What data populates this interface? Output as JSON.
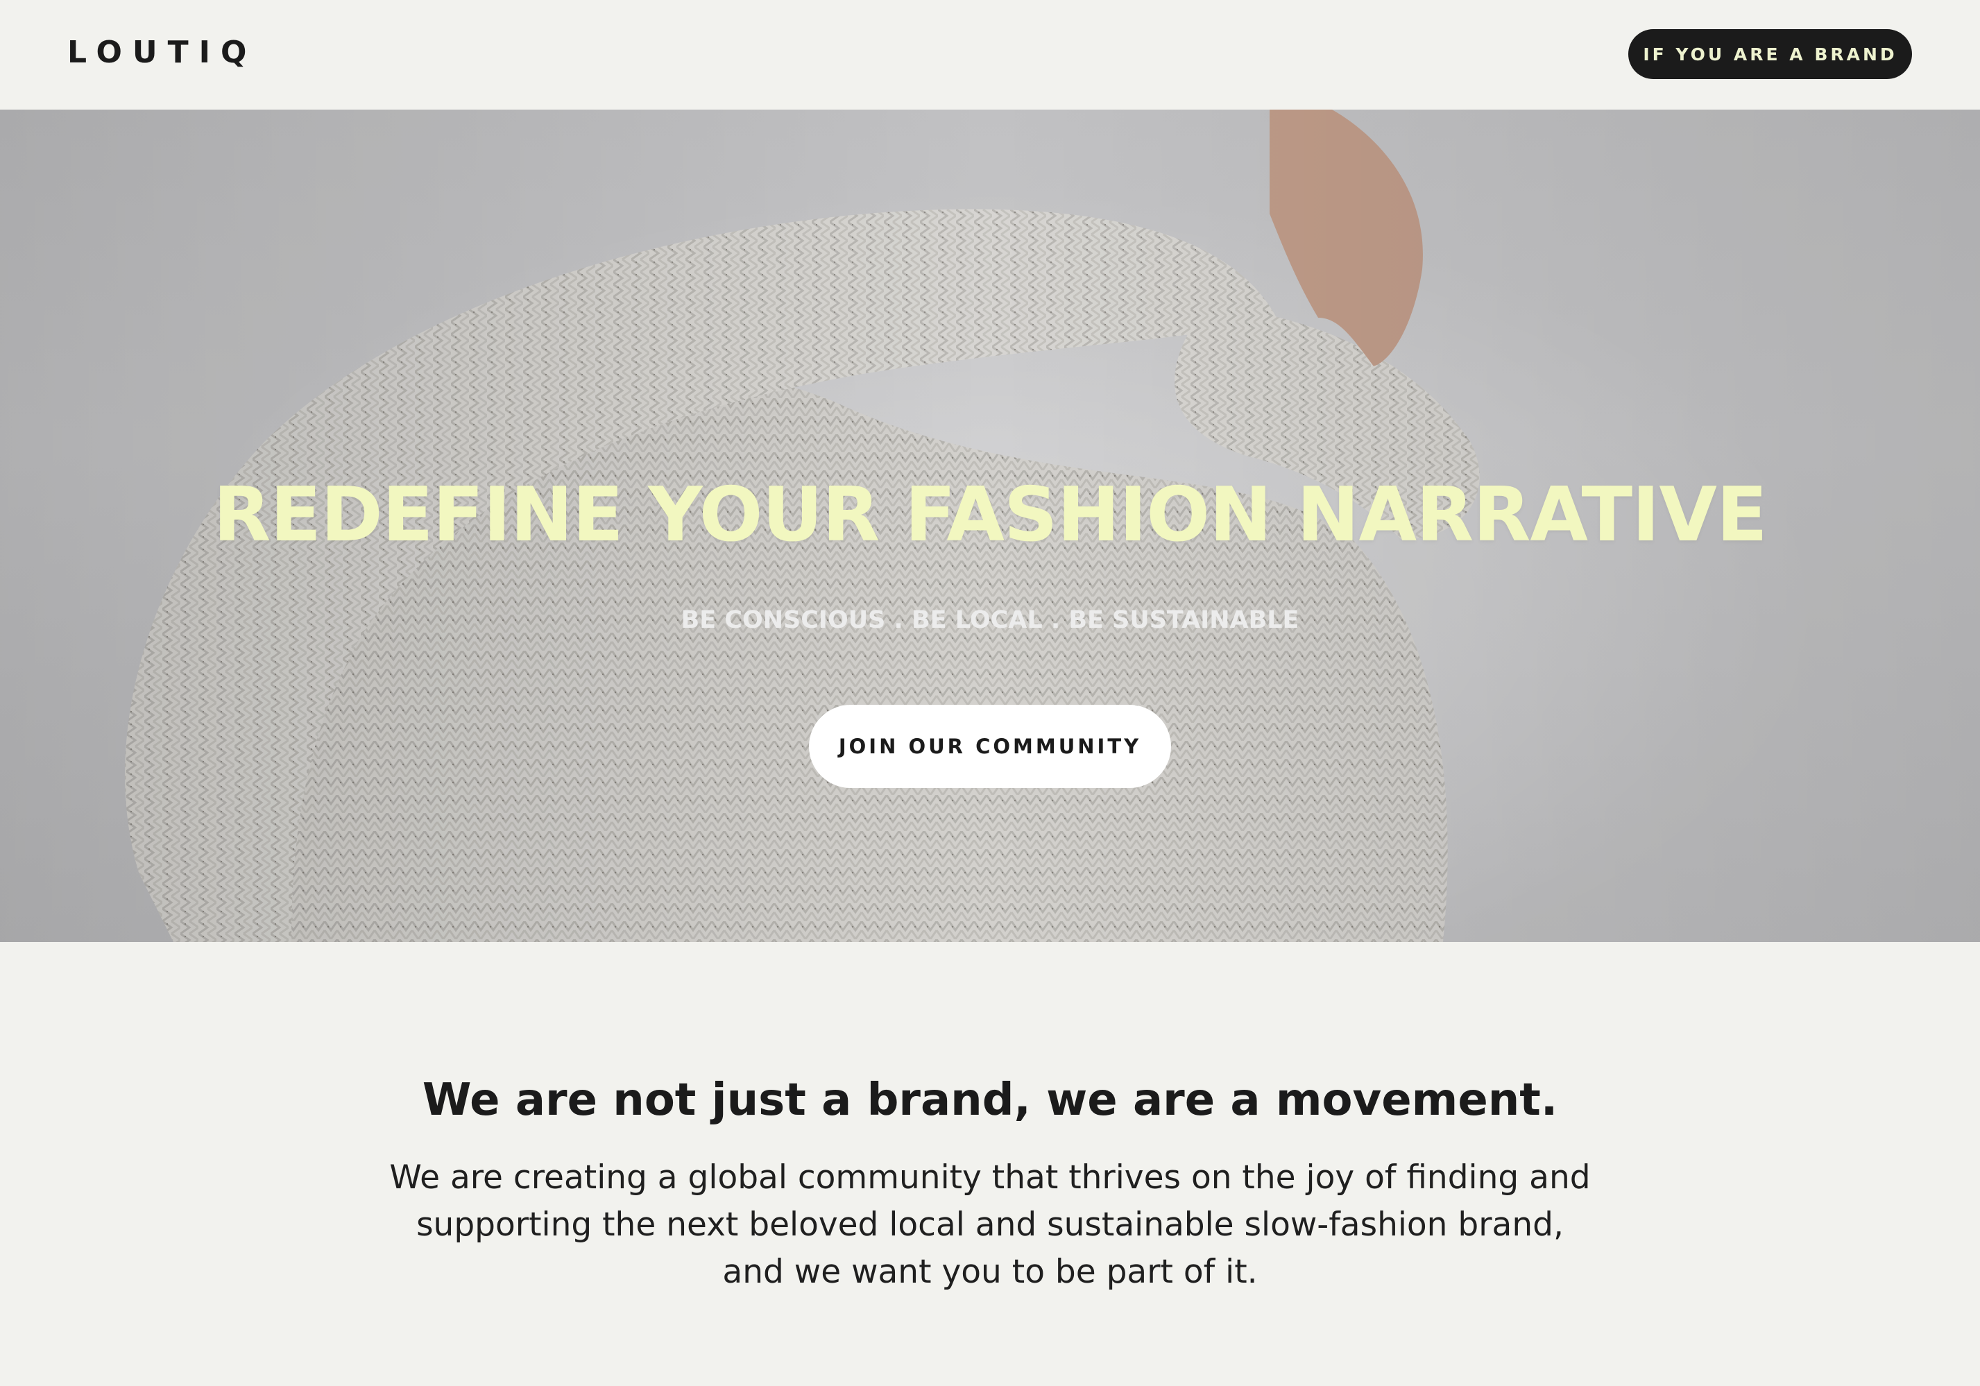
{
  "header": {
    "logo": "LOUTIQ",
    "brand_button_label": "IF YOU ARE A BRAND"
  },
  "hero": {
    "title": "REDEFINE YOUR FASHION NARRATIVE",
    "subtitle": "BE CONSCIOUS . BE LOCAL . BE SUSTAINABLE",
    "cta_label": "JOIN OUR COMMUNITY",
    "image": "knit-sweater-photo"
  },
  "movement": {
    "heading": "We are not just a brand, we are a movement.",
    "body_lines": [
      "We are creating a global community that thrives on the joy of finding and",
      "supporting the next beloved local and sustainable slow-fashion brand,",
      "and we want you to be part of it."
    ]
  },
  "colors": {
    "background": "#f2f2ee",
    "dark": "#1b1b1b",
    "accent": "#f2f7c0",
    "button_text_accent": "#eef3cf"
  }
}
